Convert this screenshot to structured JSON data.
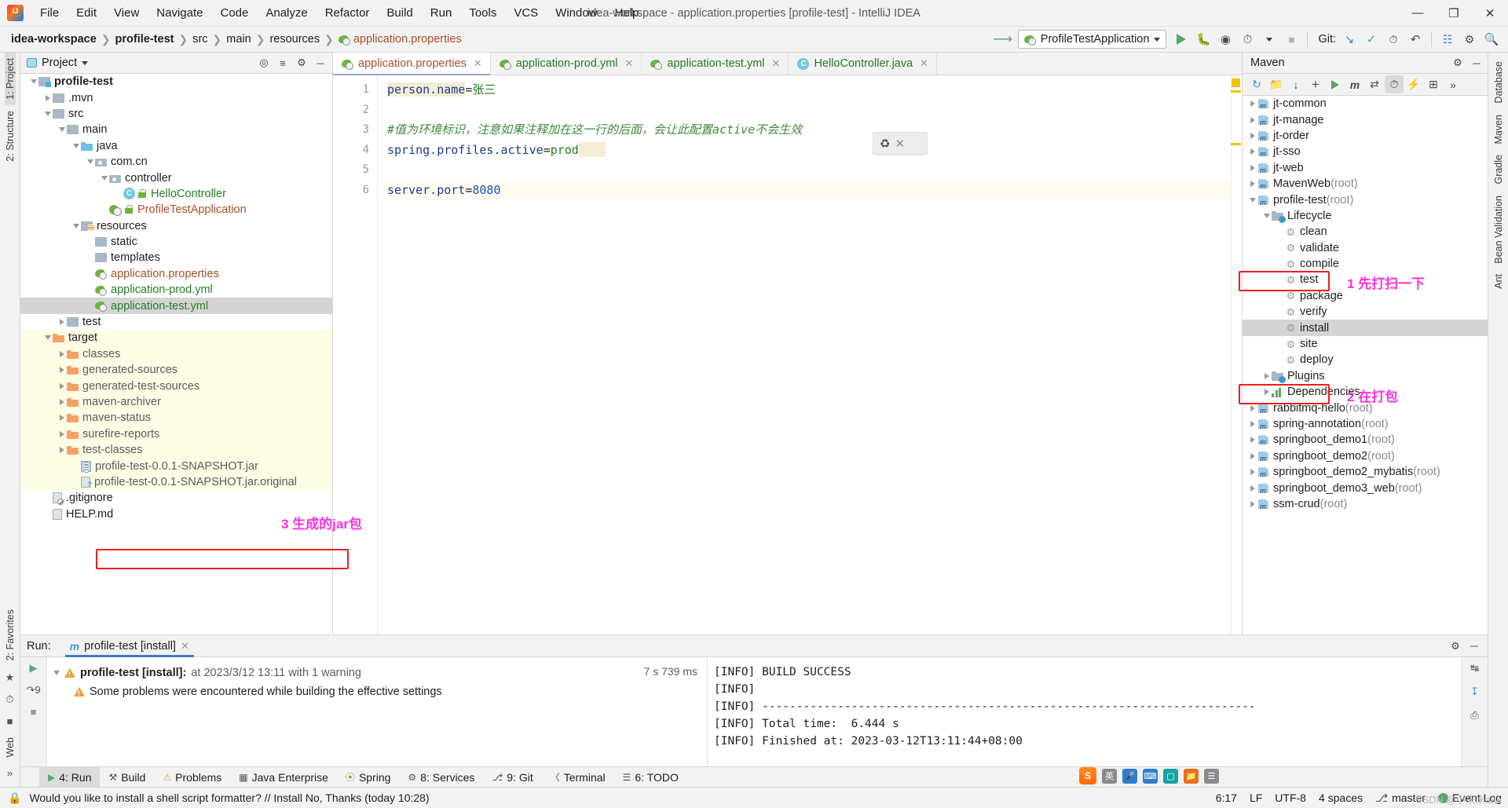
{
  "window": {
    "title": "idea-workspace - application.properties [profile-test] - IntelliJ IDEA",
    "minimize": "—",
    "maximize": "❐",
    "close": "✕"
  },
  "menu": [
    "File",
    "Edit",
    "View",
    "Navigate",
    "Code",
    "Analyze",
    "Refactor",
    "Build",
    "Run",
    "Tools",
    "VCS",
    "Window",
    "Help"
  ],
  "breadcrumb": {
    "items": [
      "idea-workspace",
      "profile-test",
      "src",
      "main",
      "resources"
    ],
    "file": "application.properties",
    "separator": "❯"
  },
  "toolbar": {
    "run_config": "ProfileTestApplication",
    "git_label": "Git:",
    "icons": [
      "update-project-icon",
      "run-icon",
      "debug-icon",
      "run-with-coverage-icon",
      "profile-icon",
      "stop-icon",
      "git-update-icon",
      "git-commit-icon",
      "git-history-icon",
      "git-rollback-icon",
      "search-everywhere-icon"
    ]
  },
  "left_rail": {
    "tabs": [
      "1: Project",
      "2: Structure"
    ],
    "bottom": [
      "2: Favorites",
      "Web"
    ]
  },
  "right_rail": {
    "tabs": [
      "Database",
      "Maven",
      "Gradle",
      "Bean Validation",
      "Ant"
    ]
  },
  "project_panel": {
    "title": "Project",
    "tools": [
      "locate-icon",
      "collapse-all-icon",
      "settings-icon",
      "hide-icon"
    ],
    "tree": [
      {
        "indent": 1,
        "arrow": "down",
        "icon": "module-folder",
        "label": "profile-test",
        "style": "bold-dark",
        "row": "plain"
      },
      {
        "indent": 2,
        "arrow": "right",
        "icon": "folder-grey",
        "label": ".mvn",
        "style": "dark",
        "row": "plain"
      },
      {
        "indent": 2,
        "arrow": "down",
        "icon": "folder-grey",
        "label": "src",
        "style": "dark",
        "row": "plain"
      },
      {
        "indent": 3,
        "arrow": "down",
        "icon": "folder-grey",
        "label": "main",
        "style": "dark",
        "row": "plain"
      },
      {
        "indent": 4,
        "arrow": "down",
        "icon": "folder-blue",
        "label": "java",
        "style": "dark",
        "row": "plain"
      },
      {
        "indent": 5,
        "arrow": "down",
        "icon": "package",
        "label": "com.cn",
        "style": "dark",
        "row": "plain"
      },
      {
        "indent": 6,
        "arrow": "down",
        "icon": "package",
        "label": "controller",
        "style": "dark",
        "row": "plain"
      },
      {
        "indent": 7,
        "arrow": "none",
        "icon": "class-lock",
        "label": "HelloController",
        "style": "green",
        "row": "plain"
      },
      {
        "indent": 6,
        "arrow": "none",
        "icon": "spring-class-lock",
        "label": "ProfileTestApplication",
        "style": "red",
        "row": "plain"
      },
      {
        "indent": 4,
        "arrow": "down",
        "icon": "folder-resources",
        "label": "resources",
        "style": "dark",
        "row": "plain"
      },
      {
        "indent": 5,
        "arrow": "none",
        "icon": "folder-grey",
        "label": "static",
        "style": "dark",
        "row": "plain"
      },
      {
        "indent": 5,
        "arrow": "none",
        "icon": "folder-grey",
        "label": "templates",
        "style": "dark",
        "row": "plain"
      },
      {
        "indent": 5,
        "arrow": "none",
        "icon": "spring-file",
        "label": "application.properties",
        "style": "red",
        "row": "plain"
      },
      {
        "indent": 5,
        "arrow": "none",
        "icon": "spring-file",
        "label": "application-prod.yml",
        "style": "green",
        "row": "plain"
      },
      {
        "indent": 5,
        "arrow": "none",
        "icon": "spring-file",
        "label": "application-test.yml",
        "style": "green",
        "row": "selected"
      },
      {
        "indent": 3,
        "arrow": "right",
        "icon": "folder-grey",
        "label": "test",
        "style": "dark",
        "row": "plain"
      },
      {
        "indent": 2,
        "arrow": "down",
        "icon": "folder-orange",
        "label": "target",
        "style": "dark",
        "row": "target"
      },
      {
        "indent": 3,
        "arrow": "right",
        "icon": "folder-orange",
        "label": "classes",
        "style": "grey",
        "row": "target"
      },
      {
        "indent": 3,
        "arrow": "right",
        "icon": "folder-orange",
        "label": "generated-sources",
        "style": "grey",
        "row": "target"
      },
      {
        "indent": 3,
        "arrow": "right",
        "icon": "folder-orange",
        "label": "generated-test-sources",
        "style": "grey",
        "row": "target"
      },
      {
        "indent": 3,
        "arrow": "right",
        "icon": "folder-orange",
        "label": "maven-archiver",
        "style": "grey",
        "row": "target"
      },
      {
        "indent": 3,
        "arrow": "right",
        "icon": "folder-orange",
        "label": "maven-status",
        "style": "grey",
        "row": "target"
      },
      {
        "indent": 3,
        "arrow": "right",
        "icon": "folder-orange",
        "label": "surefire-reports",
        "style": "grey",
        "row": "target"
      },
      {
        "indent": 3,
        "arrow": "right",
        "icon": "folder-orange",
        "label": "test-classes",
        "style": "grey",
        "row": "target"
      },
      {
        "indent": 4,
        "arrow": "none",
        "icon": "jar",
        "label": "profile-test-0.0.1-SNAPSHOT.jar",
        "style": "grey",
        "row": "target"
      },
      {
        "indent": 4,
        "arrow": "none",
        "icon": "file-unknown",
        "label": "profile-test-0.0.1-SNAPSHOT.jar.original",
        "style": "grey",
        "row": "target"
      },
      {
        "indent": 2,
        "arrow": "none",
        "icon": "file-ignored",
        "label": ".gitignore",
        "style": "dark",
        "row": "plain"
      },
      {
        "indent": 2,
        "arrow": "none",
        "icon": "file-md",
        "label": "HELP.md",
        "style": "dark",
        "row": "plain"
      }
    ],
    "annotation": {
      "number": "3",
      "text": "3 生成的jar包"
    }
  },
  "editor": {
    "tabs": [
      {
        "label": "application.properties",
        "icon": "spring-file-icon",
        "active": true
      },
      {
        "label": "application-prod.yml",
        "icon": "spring-file-icon",
        "active": false
      },
      {
        "label": "application-test.yml",
        "icon": "spring-file-icon",
        "active": false
      },
      {
        "label": "HelloController.java",
        "icon": "java-class-icon",
        "active": false
      }
    ],
    "line_numbers": [
      "1",
      "2",
      "3",
      "4",
      "5",
      "6"
    ],
    "lines": [
      {
        "n": 1,
        "key": "person.name",
        "eq": "=",
        "val": "张三",
        "type": "prop"
      },
      {
        "n": 2,
        "text": "",
        "type": "blank"
      },
      {
        "n": 3,
        "text": "#值为环境标识，注意如果注释加在这一行的后面，会让此配置active不会生效",
        "type": "comment"
      },
      {
        "n": 4,
        "key": "spring.profiles.active",
        "eq": "=",
        "val": "prod",
        "type": "prop-caret"
      },
      {
        "n": 5,
        "text": "",
        "type": "blank"
      },
      {
        "n": 6,
        "key": "server.port",
        "eq": "=",
        "val": "8080",
        "type": "prop-num"
      }
    ],
    "floating_widget": {
      "icon": "maven-reimport-icon",
      "close": "✕"
    }
  },
  "maven_panel": {
    "title": "Maven",
    "head_tools": [
      "settings-icon",
      "hide-icon"
    ],
    "toolbar_icons": [
      "reimport-icon",
      "generate-sources-icon",
      "download-sources-icon",
      "add-icon",
      "run-icon",
      "execute-goal-icon",
      "toggle-skip-tests-icon",
      "show-history-icon",
      "offline-mode-icon",
      "expand-icon",
      "more-icon"
    ],
    "tree": [
      {
        "indent": 1,
        "arrow": "right",
        "icon": "maven-module",
        "label": "jt-common",
        "suffix": "",
        "row": "plain"
      },
      {
        "indent": 1,
        "arrow": "right",
        "icon": "maven-module",
        "label": "jt-manage",
        "suffix": "",
        "row": "plain"
      },
      {
        "indent": 1,
        "arrow": "right",
        "icon": "maven-module",
        "label": "jt-order",
        "suffix": "",
        "row": "plain"
      },
      {
        "indent": 1,
        "arrow": "right",
        "icon": "maven-module",
        "label": "jt-sso",
        "suffix": "",
        "row": "plain"
      },
      {
        "indent": 1,
        "arrow": "right",
        "icon": "maven-module",
        "label": "jt-web",
        "suffix": "",
        "row": "plain"
      },
      {
        "indent": 1,
        "arrow": "right",
        "icon": "maven-module",
        "label": "MavenWeb",
        "suffix": "(root)",
        "row": "plain"
      },
      {
        "indent": 1,
        "arrow": "down",
        "icon": "maven-module",
        "label": "profile-test",
        "suffix": "(root)",
        "row": "plain"
      },
      {
        "indent": 2,
        "arrow": "down",
        "icon": "lifecycle",
        "label": "Lifecycle",
        "suffix": "",
        "row": "plain"
      },
      {
        "indent": 3,
        "arrow": "none",
        "icon": "gear",
        "label": "clean",
        "suffix": "",
        "row": "plain"
      },
      {
        "indent": 3,
        "arrow": "none",
        "icon": "gear",
        "label": "validate",
        "suffix": "",
        "row": "plain"
      },
      {
        "indent": 3,
        "arrow": "none",
        "icon": "gear",
        "label": "compile",
        "suffix": "",
        "row": "plain"
      },
      {
        "indent": 3,
        "arrow": "none",
        "icon": "gear",
        "label": "test",
        "suffix": "",
        "row": "plain"
      },
      {
        "indent": 3,
        "arrow": "none",
        "icon": "gear",
        "label": "package",
        "suffix": "",
        "row": "plain"
      },
      {
        "indent": 3,
        "arrow": "none",
        "icon": "gear",
        "label": "verify",
        "suffix": "",
        "row": "plain"
      },
      {
        "indent": 3,
        "arrow": "none",
        "icon": "gear",
        "label": "install",
        "suffix": "",
        "row": "selected"
      },
      {
        "indent": 3,
        "arrow": "none",
        "icon": "gear",
        "label": "site",
        "suffix": "",
        "row": "plain"
      },
      {
        "indent": 3,
        "arrow": "none",
        "icon": "gear",
        "label": "deploy",
        "suffix": "",
        "row": "plain"
      },
      {
        "indent": 2,
        "arrow": "right",
        "icon": "plugins",
        "label": "Plugins",
        "suffix": "",
        "row": "plain"
      },
      {
        "indent": 2,
        "arrow": "right",
        "icon": "dependencies",
        "label": "Dependencies",
        "suffix": "",
        "row": "plain"
      },
      {
        "indent": 1,
        "arrow": "right",
        "icon": "maven-module",
        "label": "rabbitmq-hello",
        "suffix": "(root)",
        "row": "plain"
      },
      {
        "indent": 1,
        "arrow": "right",
        "icon": "maven-module",
        "label": "spring-annotation",
        "suffix": "(root)",
        "row": "plain"
      },
      {
        "indent": 1,
        "arrow": "right",
        "icon": "maven-module",
        "label": "springboot_demo1",
        "suffix": "(root)",
        "row": "plain"
      },
      {
        "indent": 1,
        "arrow": "right",
        "icon": "maven-module",
        "label": "springboot_demo2",
        "suffix": "(root)",
        "row": "plain"
      },
      {
        "indent": 1,
        "arrow": "right",
        "icon": "maven-module",
        "label": "springboot_demo2_mybatis",
        "suffix": "(root)",
        "row": "plain"
      },
      {
        "indent": 1,
        "arrow": "right",
        "icon": "maven-module",
        "label": "springboot_demo3_web",
        "suffix": "(root)",
        "row": "plain"
      },
      {
        "indent": 1,
        "arrow": "right",
        "icon": "maven-module",
        "label": "ssm-crud",
        "suffix": "(root)",
        "row": "plain"
      }
    ],
    "annotations": [
      {
        "text": "1 先打扫一下",
        "target": "clean"
      },
      {
        "text": "2 在打包",
        "target": "install"
      }
    ]
  },
  "run_panel": {
    "label": "Run:",
    "tab": "profile-test [install]",
    "tab_close": "✕",
    "tools": [
      "settings-icon",
      "hide-icon"
    ],
    "gutter_icons": [
      "rerun-icon",
      "jump-to-console-icon",
      "stop-icon"
    ],
    "tree": {
      "root_bold": "profile-test [install]:",
      "root_rest": "at 2023/3/12 13:11 with 1 warning",
      "child": "Some problems were encountered while building the effective settings",
      "duration": "7 s 739 ms"
    },
    "console": [
      "[INFO] BUILD SUCCESS",
      "[INFO]",
      "[INFO] ------------------------------------------------------------------------",
      "[INFO] Total time:  6.444 s",
      "[INFO] Finished at: 2023-03-12T13:11:44+08:00"
    ],
    "rail_icons": [
      "soft-wrap-icon",
      "scroll-to-end-icon",
      "print-icon"
    ]
  },
  "bottom_bar": {
    "items": [
      {
        "label": "4: Run",
        "icon": "run-icon",
        "selected": true
      },
      {
        "label": "Build",
        "icon": "build-icon",
        "selected": false
      },
      {
        "label": "Problems",
        "icon": "warning-icon",
        "selected": false
      },
      {
        "label": "Java Enterprise",
        "icon": "java-ee-icon",
        "selected": false
      },
      {
        "label": "Spring",
        "icon": "spring-icon",
        "selected": false
      },
      {
        "label": "8: Services",
        "icon": "services-icon",
        "selected": false
      },
      {
        "label": "9: Git",
        "icon": "git-icon",
        "selected": false
      },
      {
        "label": "Terminal",
        "icon": "terminal-icon",
        "selected": false
      },
      {
        "label": "6: TODO",
        "icon": "todo-icon",
        "selected": false
      }
    ],
    "event_log": "Event Log"
  },
  "status_bar": {
    "message": "Would you like to install a shell script formatter? // Install    No, Thanks (today 10:28)",
    "position": "6:17",
    "line_ending": "LF",
    "encoding": "UTF-8",
    "indent": "4 spaces",
    "branch": "master",
    "lock_icon": "lock-icon"
  },
  "tray": {
    "items": [
      "sogou-icon",
      "ime-icon",
      "mic-icon",
      "keyboard-icon",
      "box-icon",
      "folder-icon",
      "menu-icon"
    ],
    "ime_label": "英"
  },
  "watermark": "CSDN @小米米aaa",
  "colors": {
    "accent_green": "#59a869",
    "annotation_pink": "#ff2fe0",
    "highlight_red": "#f01e1e",
    "target_bg": "#fdfce5",
    "selected_bg": "#d4d4d4"
  }
}
